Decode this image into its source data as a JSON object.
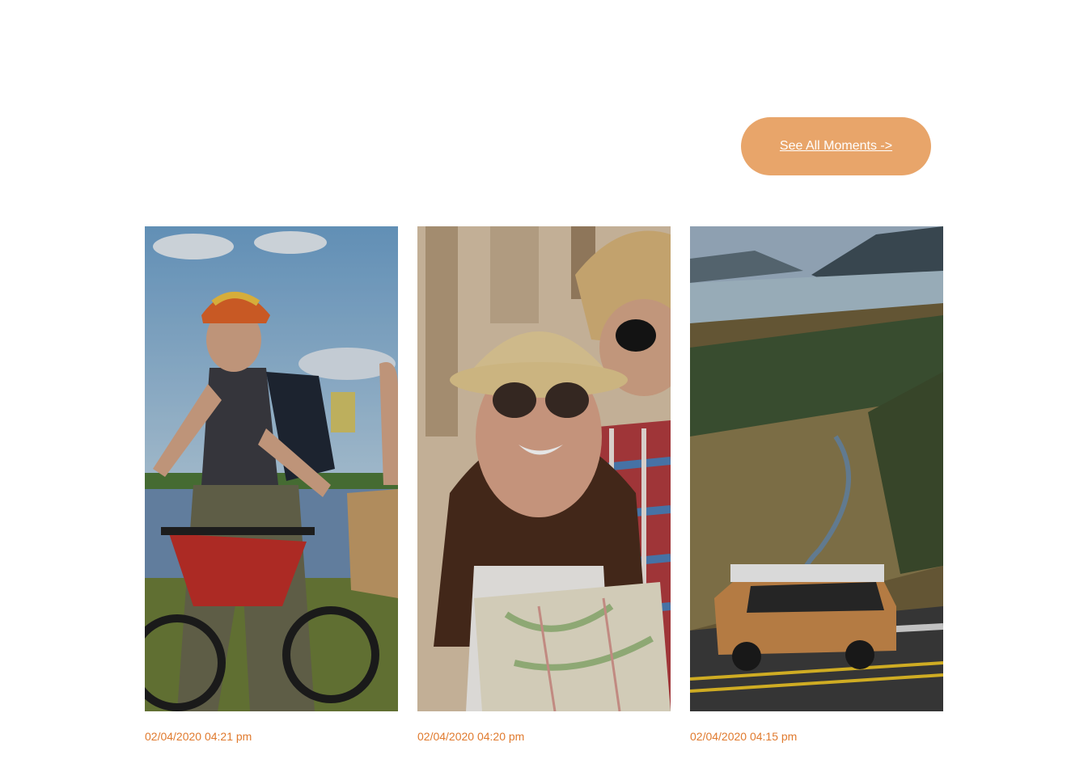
{
  "header": {
    "see_all_label": "See All Moments ->"
  },
  "moments": [
    {
      "timestamp": "02/04/2020 04:21 pm",
      "photo": "cyclists-lake-photo"
    },
    {
      "timestamp": "02/04/2020 04:20 pm",
      "photo": "tourist-couple-map-photo"
    },
    {
      "timestamp": "02/04/2020 04:15 pm",
      "photo": "van-valley-road-photo"
    }
  ],
  "colors": {
    "button_bg": "#e8a56a",
    "button_text": "#ffffff",
    "timestamp_text": "#e07a2e"
  }
}
